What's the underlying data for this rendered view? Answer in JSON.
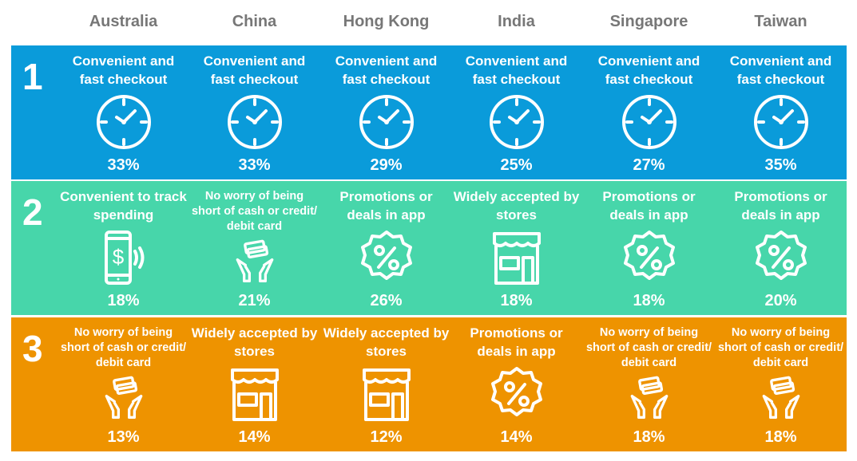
{
  "columns": [
    "Australia",
    "China",
    "Hong Kong",
    "India",
    "Singapore",
    "Taiwan"
  ],
  "rows": [
    {
      "rank": "1",
      "color": "#0A9BDA",
      "cells": [
        {
          "label": "Convenient and fast checkout",
          "icon": "clock",
          "pct": "33%"
        },
        {
          "label": "Convenient and fast checkout",
          "icon": "clock",
          "pct": "33%"
        },
        {
          "label": "Convenient and fast checkout",
          "icon": "clock",
          "pct": "29%"
        },
        {
          "label": "Convenient and fast checkout",
          "icon": "clock",
          "pct": "25%"
        },
        {
          "label": "Convenient and fast checkout",
          "icon": "clock",
          "pct": "27%"
        },
        {
          "label": "Convenient and fast checkout",
          "icon": "clock",
          "pct": "35%"
        }
      ]
    },
    {
      "rank": "2",
      "color": "#47D6AA",
      "cells": [
        {
          "label": "Convenient to track spending",
          "icon": "phone-payment",
          "pct": "18%"
        },
        {
          "label": "No worry of being short of cash or credit/ debit card",
          "icon": "hands-cash",
          "pct": "21%"
        },
        {
          "label": "Promotions or deals in app",
          "icon": "percent-badge",
          "pct": "26%"
        },
        {
          "label": "Widely accepted by stores",
          "icon": "store",
          "pct": "18%"
        },
        {
          "label": "Promotions or deals in app",
          "icon": "percent-badge",
          "pct": "18%"
        },
        {
          "label": "Promotions or deals in app",
          "icon": "percent-badge",
          "pct": "20%"
        }
      ]
    },
    {
      "rank": "3",
      "color": "#EE9300",
      "cells": [
        {
          "label": "No worry of being short of cash or credit/ debit card",
          "icon": "hands-cash",
          "pct": "13%"
        },
        {
          "label": "Widely accepted by stores",
          "icon": "store",
          "pct": "14%"
        },
        {
          "label": "Widely accepted by stores",
          "icon": "store",
          "pct": "12%"
        },
        {
          "label": "Promotions or deals in app",
          "icon": "percent-badge",
          "pct": "14%"
        },
        {
          "label": "No worry of being short of cash or credit/ debit card",
          "icon": "hands-cash",
          "pct": "18%"
        },
        {
          "label": "No worry of being short of cash or credit/ debit card",
          "icon": "hands-cash",
          "pct": "18%"
        }
      ]
    }
  ]
}
